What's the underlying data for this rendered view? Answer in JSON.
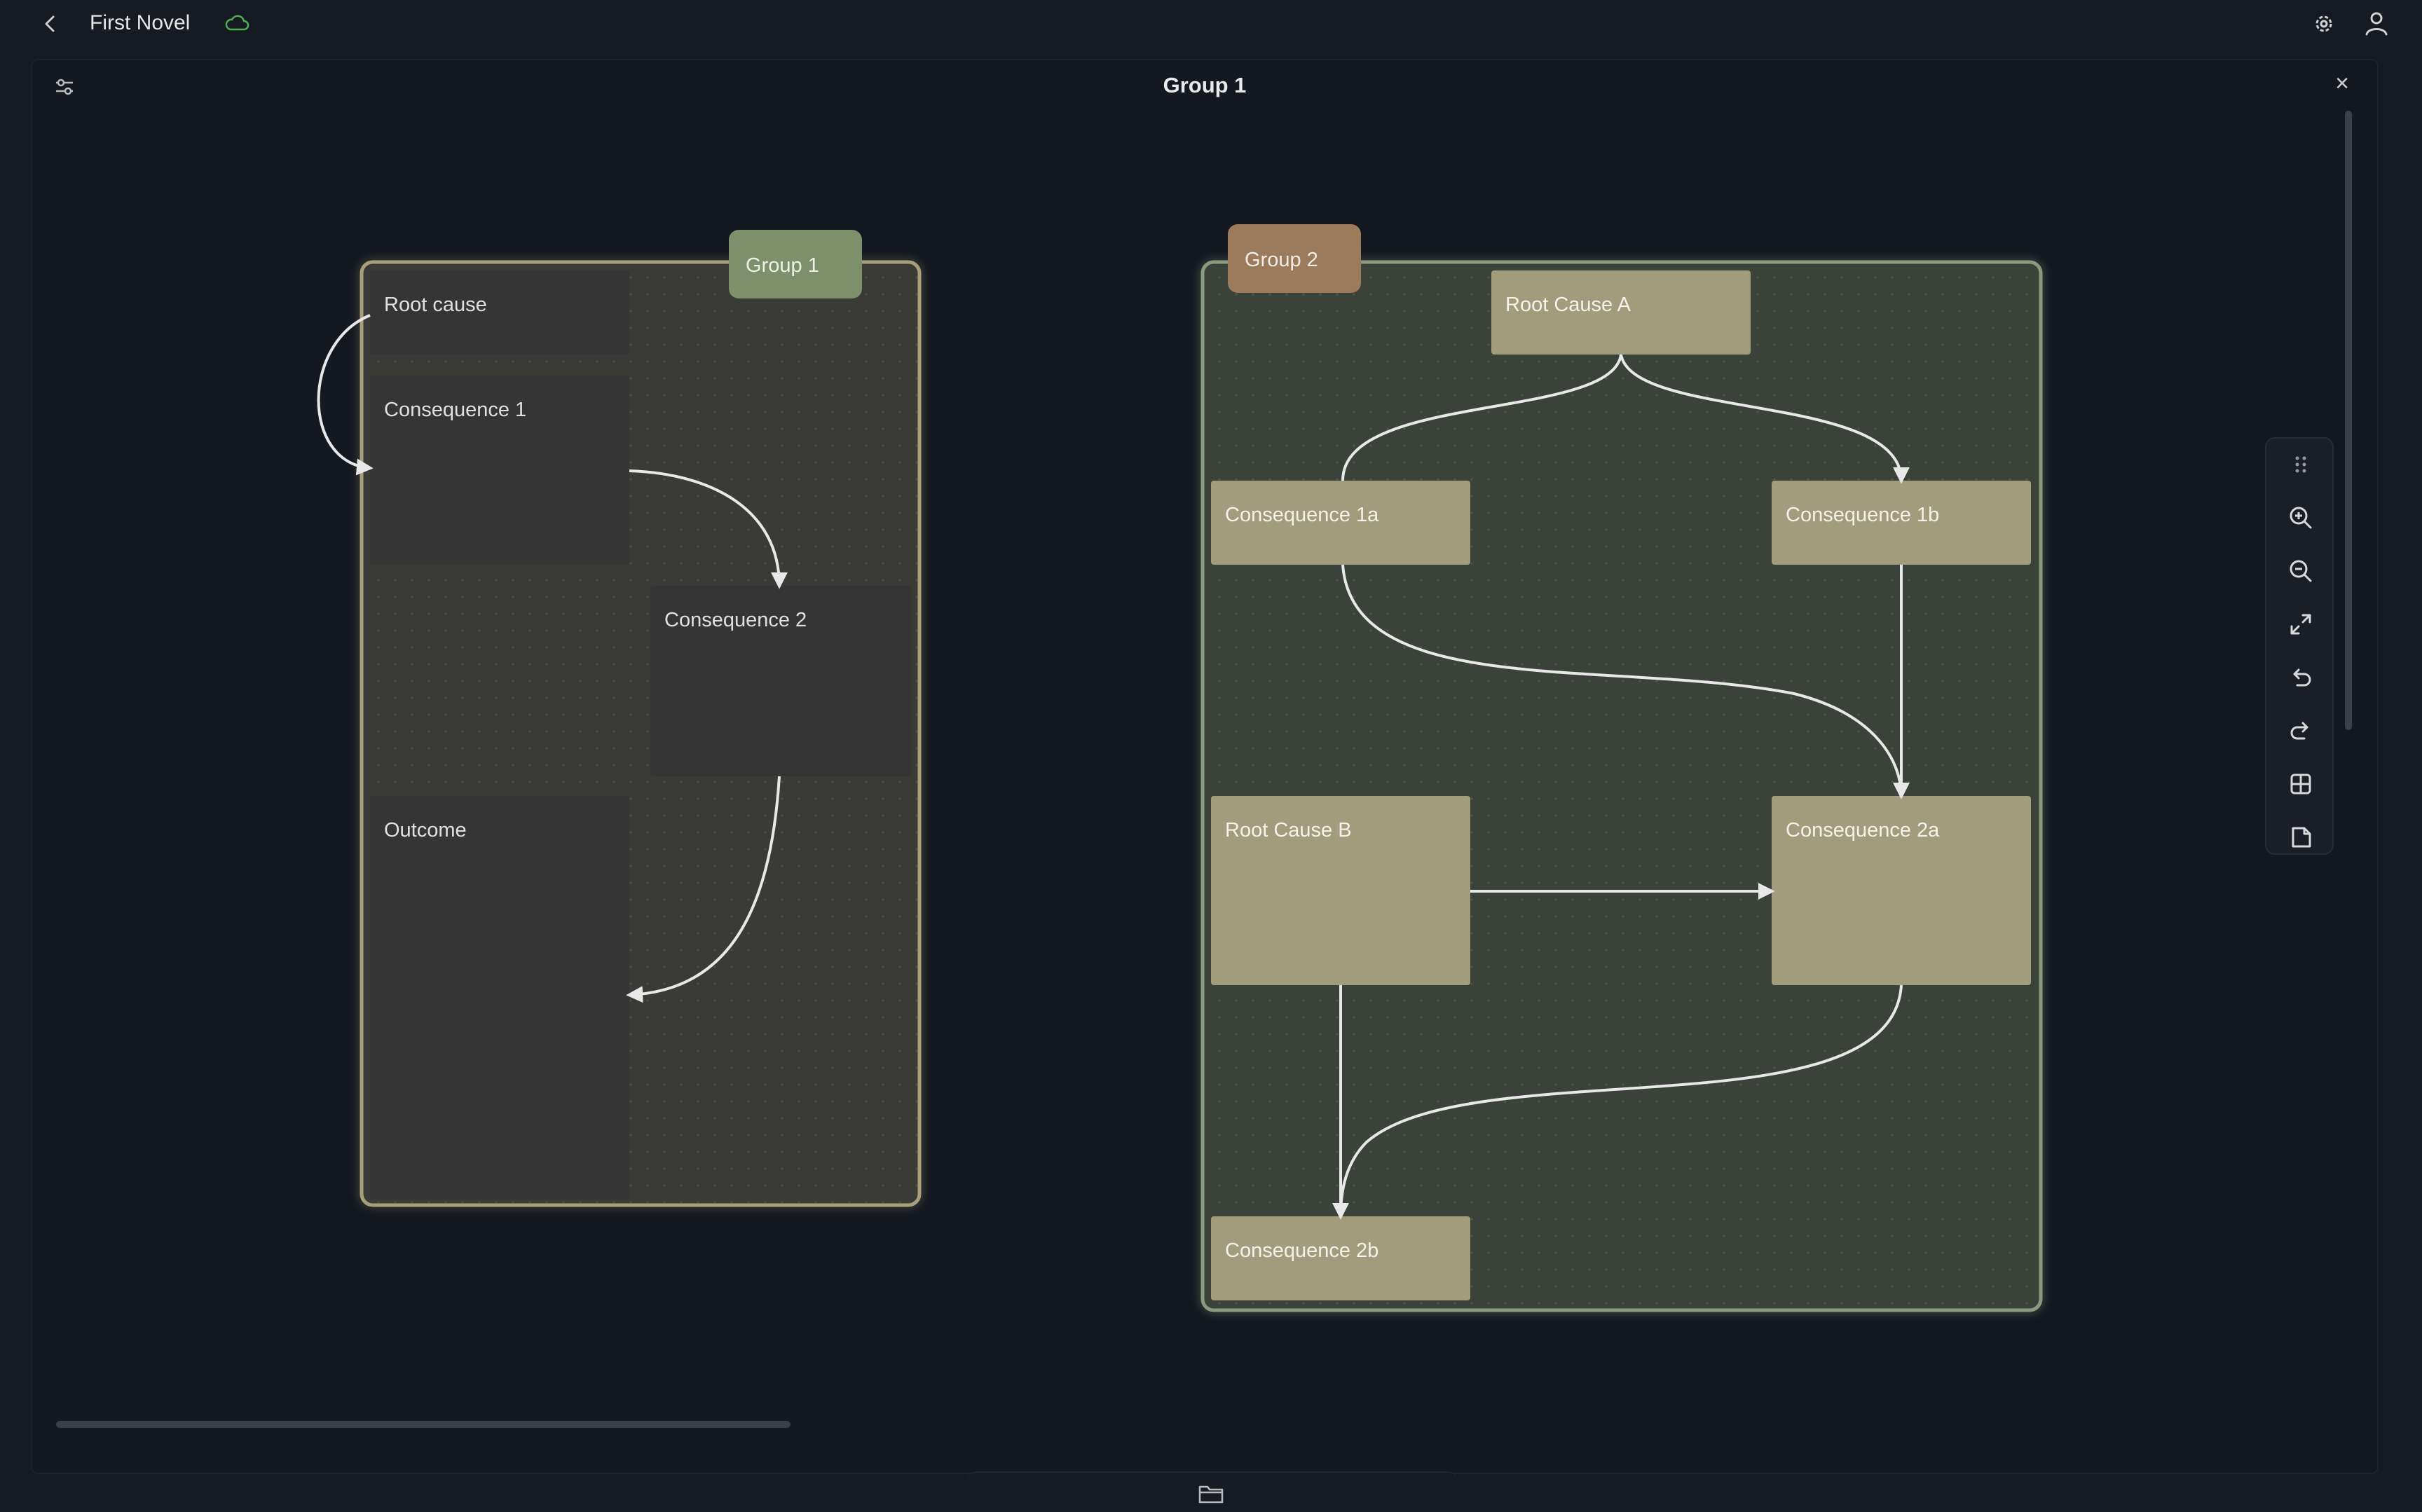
{
  "topbar": {
    "title": "First Novel"
  },
  "panel": {
    "title": "Group 1",
    "close_glyph": "×"
  },
  "icons": {
    "back": "chevron-left-icon",
    "sync": "cloud-icon",
    "settings": "gear-icon",
    "account": "user-icon",
    "filter": "sliders-icon",
    "folder": "folder-icon"
  },
  "colors": {
    "background": "#161a22",
    "group1_fill": "#3a3a36",
    "group1_border": "#a8a07a",
    "group1_label": "#7e8f6c",
    "group2_fill": "#3b4239",
    "group2_border": "#8a9a7c",
    "group2_label": "#9c7a5c",
    "card_dark": "#353535",
    "card_tan": "#a09c7c",
    "sync_ok": "#4caf50"
  },
  "groups": [
    {
      "label": "Group 1"
    },
    {
      "label": "Group 2"
    }
  ],
  "cards": {
    "root_cause": "Root cause",
    "consequence_1": "Consequence 1",
    "consequence_2": "Consequence 2",
    "outcome": "Outcome",
    "root_cause_a": "Root Cause A",
    "consequence_1a": "Consequence 1a",
    "consequence_1b": "Consequence 1b",
    "root_cause_b": "Root Cause B",
    "consequence_2a": "Consequence 2a",
    "consequence_2b": "Consequence 2b"
  },
  "toolbar": [
    {
      "name": "drag-handle-icon"
    },
    {
      "name": "zoom-in-icon"
    },
    {
      "name": "zoom-out-icon"
    },
    {
      "name": "fit-screen-icon"
    },
    {
      "name": "undo-icon"
    },
    {
      "name": "redo-icon"
    },
    {
      "name": "grid-icon"
    },
    {
      "name": "note-icon"
    }
  ]
}
